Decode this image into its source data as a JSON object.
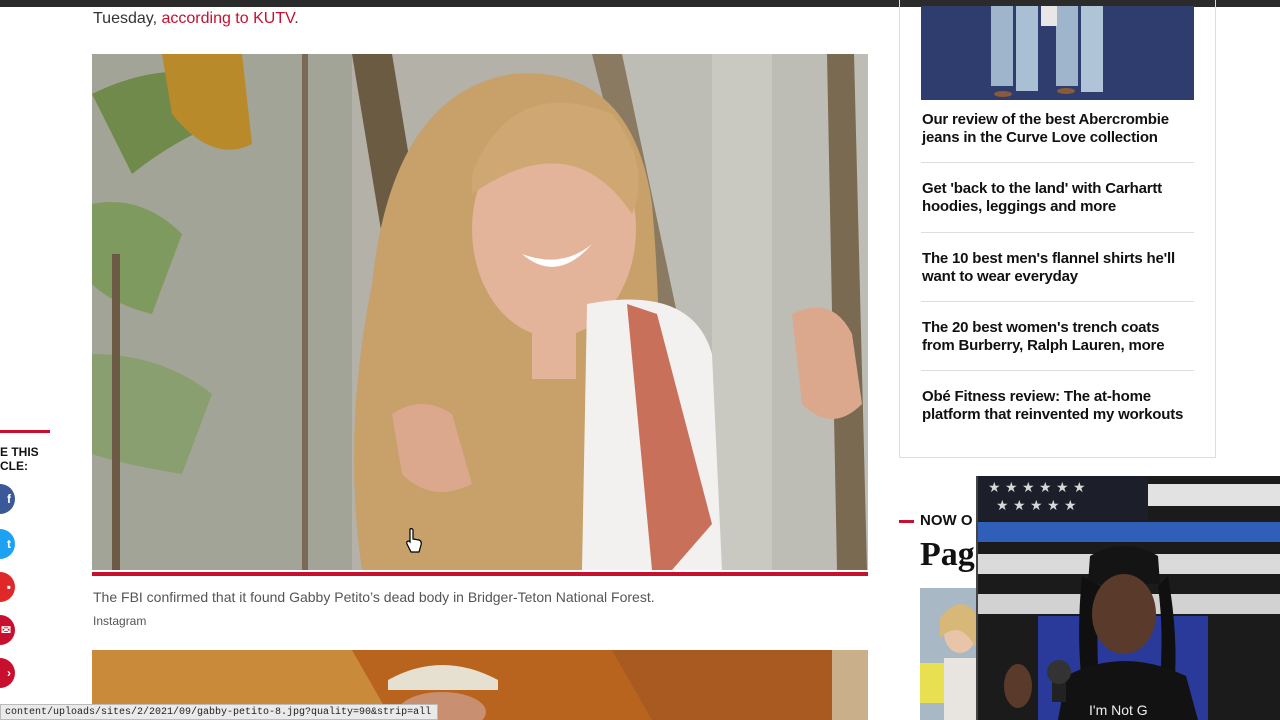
{
  "article": {
    "lead_text": "Tuesday, ",
    "lead_link": "according to KUTV",
    "lead_end": ".",
    "caption": "The FBI confirmed that it found Gabby Petito’s dead body in Bridger-Teton National Forest.",
    "credit": "Instagram"
  },
  "share": {
    "label_line1": "E THIS",
    "label_line2": "CLE:",
    "icons": [
      "facebook-icon",
      "twitter-icon",
      "flipboard-icon",
      "email-icon",
      "more-icon"
    ]
  },
  "sidebar": {
    "promos": [
      "Our review of the best Abercrombie jeans in the Curve Love collection",
      "Get 'back to the land' with Carhartt hoodies, leggings and more",
      "The 10 best men's flannel shirts he'll want to wear everyday",
      "The 20 best women's trench coats from Burberry, Ralph Lauren, more",
      "Obé Fitness review: The at-home platform that reinvented my workouts"
    ],
    "now_label": "NOW O",
    "page_label": "Pag"
  },
  "status_bar": {
    "url": "content/uploads/sites/2/2021/09/gabby-petito-8.jpg?quality=90&strip=all"
  },
  "webcam": {
    "shirt_text": "I'm Not G"
  },
  "colors": {
    "accent_red": "#c8102e",
    "facebook": "#3b5998",
    "twitter": "#1da1f2"
  }
}
